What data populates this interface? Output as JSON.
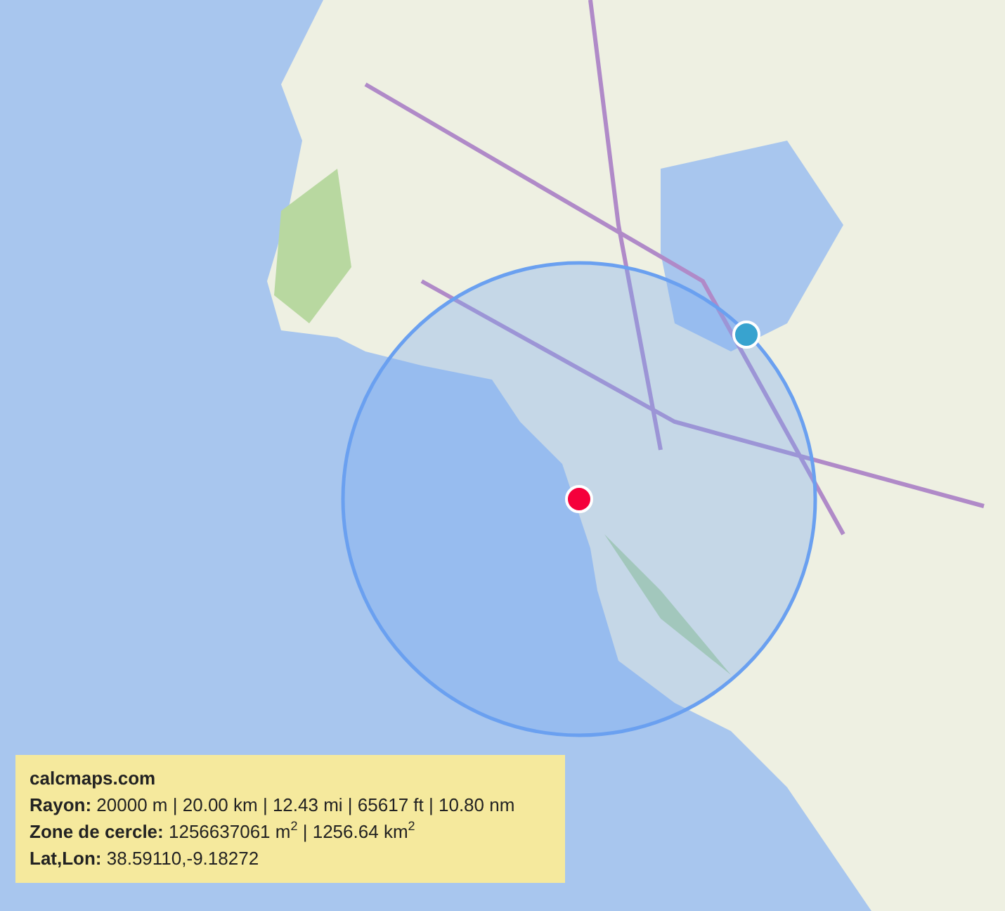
{
  "map": {
    "circle": {
      "visible": true
    },
    "markers": [
      {
        "kind": "center",
        "color": "#f5003b"
      },
      {
        "kind": "edge",
        "color": "#38a3cf"
      }
    ]
  },
  "info_panel": {
    "title": "calcmaps.com",
    "lines": [
      "**Rayon:** 20000 m | 20.00 km | 12.43 mi | 65617 ft | 10.80 nm",
      "**Zone de cercle:** 1256637061 m$^{2}$ | 1256.64 km$^{2}$",
      "**Lat,Lon:** 38.59110,-9.18272"
    ]
  }
}
